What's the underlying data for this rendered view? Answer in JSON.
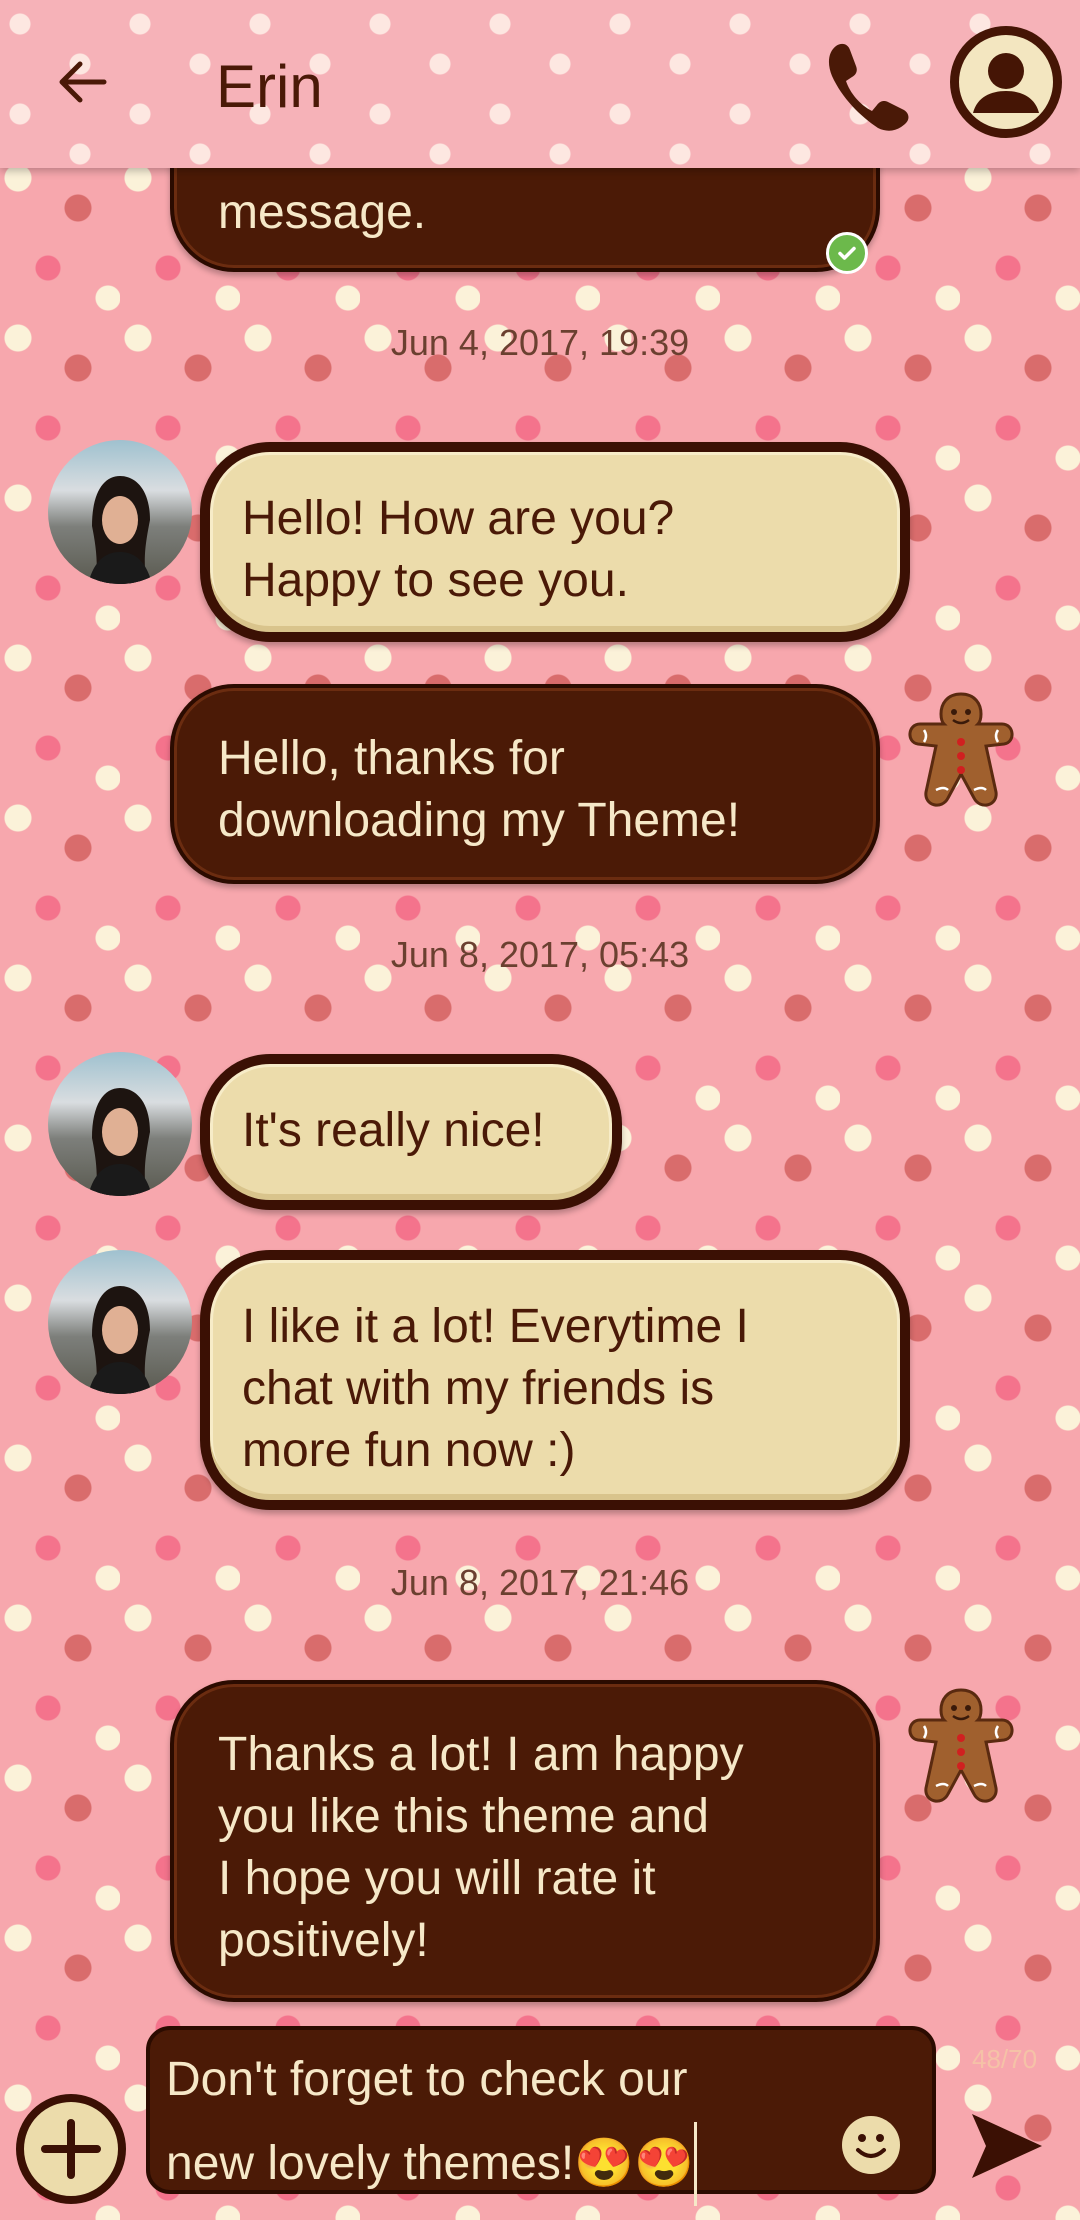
{
  "header": {
    "title": "Erin",
    "back_icon": "arrow-left-icon",
    "call_icon": "phone-icon",
    "contact_icon": "person-icon"
  },
  "messages": [
    {
      "type": "out",
      "text": "message.",
      "status": "delivered"
    },
    {
      "type": "time",
      "text": "Jun 4, 2017, 19:39"
    },
    {
      "type": "in",
      "lines": [
        "Hello! How are you?",
        "Happy to see you."
      ]
    },
    {
      "type": "out",
      "lines": [
        "Hello, thanks for",
        "downloading my Theme!"
      ]
    },
    {
      "type": "time",
      "text": "Jun 8, 2017, 05:43"
    },
    {
      "type": "in",
      "lines": [
        "It's really nice!"
      ]
    },
    {
      "type": "in",
      "lines": [
        "I like it a lot! Everytime I",
        "chat with my friends is",
        "more fun now :)"
      ]
    },
    {
      "type": "time",
      "text": "Jun 8, 2017, 21:46"
    },
    {
      "type": "out",
      "lines": [
        "Thanks a lot! I am happy",
        "you like this theme and",
        "I hope you will rate it",
        "positively!"
      ]
    }
  ],
  "composer": {
    "line1": "Don't forget to check our",
    "line2": "new lovely themes!😍😍",
    "char_counter": "48/70",
    "add_icon": "plus-icon",
    "emoji_icon": "smiley-icon",
    "send_icon": "send-icon"
  },
  "colors": {
    "background": "#f7a7ad",
    "outgoing_bubble": "#4b1a06",
    "incoming_bubble": "#ecdcab",
    "text_dark": "#4a1907",
    "text_light": "#f6e8c8"
  }
}
